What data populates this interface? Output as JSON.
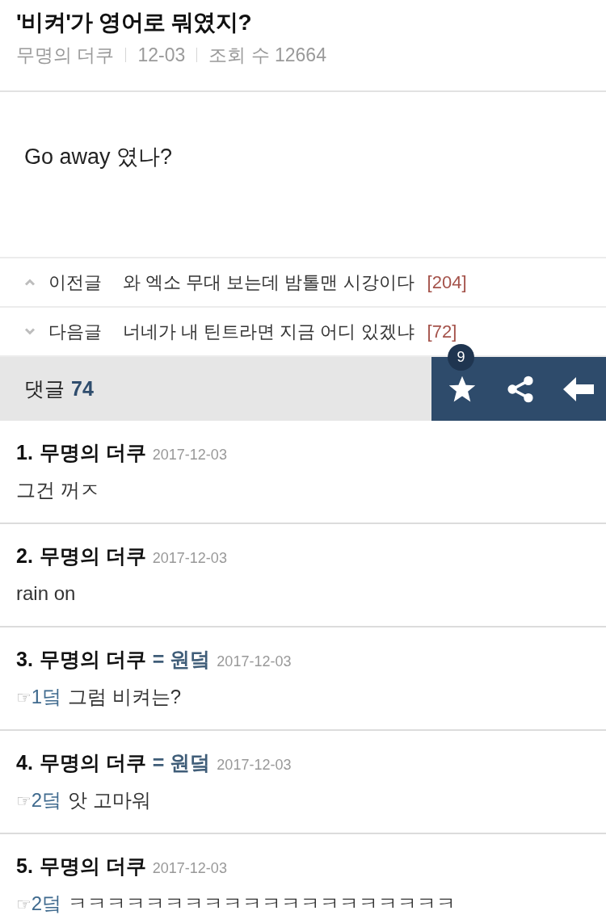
{
  "post": {
    "title": "'비켜'가 영어로 뭐였지?",
    "author": "무명의 더쿠",
    "date": "12-03",
    "views": "조회 수 12664",
    "body": "Go away 였나?"
  },
  "navigation": [
    {
      "kind": "previous",
      "label": "이전글",
      "title": "와 엑소 무대 보는데 밤톨맨 시강이다",
      "count": "[204]"
    },
    {
      "kind": "next",
      "label": "다음글",
      "title": "너네가 내 틴트라면 지금 어디 있겠냐",
      "count": "[72]"
    }
  ],
  "comments_bar": {
    "label": "댓글",
    "count": "74",
    "favorite_count": "9"
  },
  "comments": [
    {
      "number": "1.",
      "author": "무명의 더쿠",
      "date": "2017-12-03",
      "text": "그건 꺼ㅈ"
    },
    {
      "number": "2.",
      "author": "무명의 더쿠",
      "date": "2017-12-03",
      "text": "rain on"
    },
    {
      "number": "3.",
      "author": "무명의 더쿠",
      "op_label": "= 원덬",
      "date": "2017-12-03",
      "reply_to": {
        "mark": "☞",
        "target": "1덬"
      },
      "text": "그럼 비켜는?"
    },
    {
      "number": "4.",
      "author": "무명의 더쿠",
      "op_label": "= 원덬",
      "date": "2017-12-03",
      "reply_to": {
        "mark": "☞",
        "target": "2덬"
      },
      "text": "앗 고마워"
    },
    {
      "number": "5.",
      "author": "무명의 더쿠",
      "date": "2017-12-03",
      "reply_to": {
        "mark": "☞",
        "target": "2덬"
      },
      "text": "ㅋㅋㅋㅋㅋㅋㅋㅋㅋㅋㅋㅋㅋㅋㅋㅋㅋㅋㅋㅋ"
    }
  ]
}
